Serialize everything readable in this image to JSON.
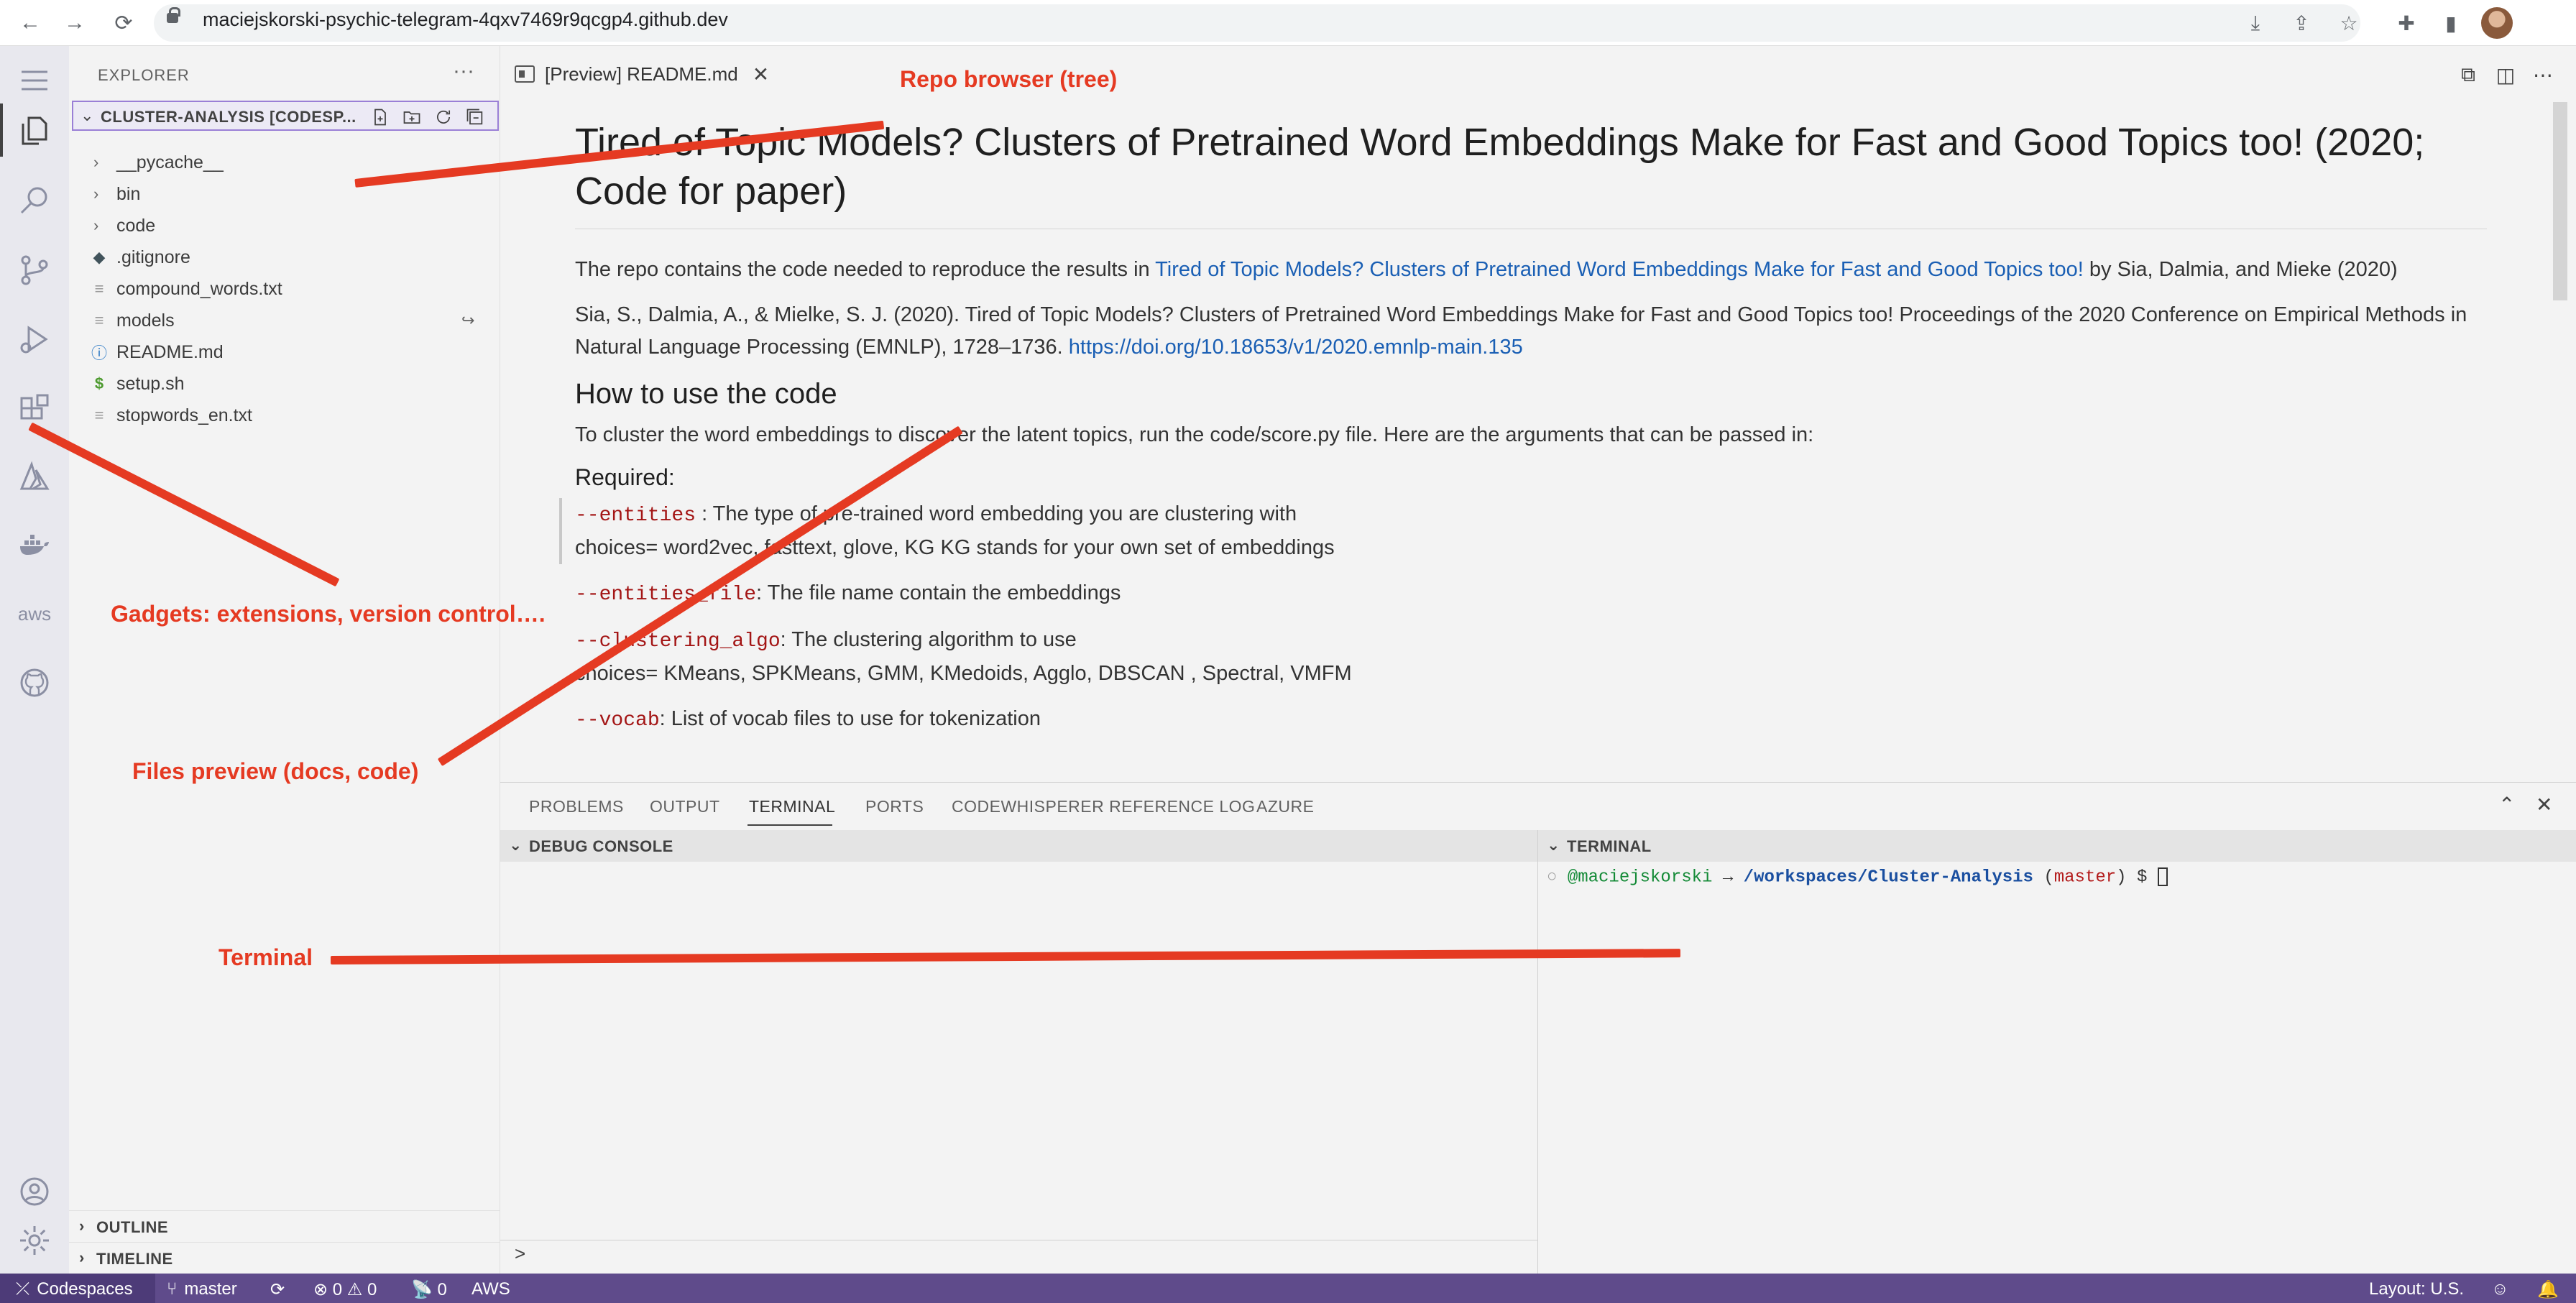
{
  "browser": {
    "url": "maciejskorski-psychic-telegram-4qxv7469r9qcgp4.github.dev"
  },
  "explorer": {
    "title": "EXPLORER",
    "more": "···",
    "repo_name": "CLUSTER-ANALYSIS [CODESP...",
    "files": [
      {
        "name": "__pycache__",
        "type": "folder"
      },
      {
        "name": "bin",
        "type": "folder"
      },
      {
        "name": "code",
        "type": "folder"
      },
      {
        "name": ".gitignore",
        "type": "git"
      },
      {
        "name": "compound_words.txt",
        "type": "text"
      },
      {
        "name": "models",
        "type": "text"
      },
      {
        "name": "README.md",
        "type": "info"
      },
      {
        "name": "setup.sh",
        "type": "shell"
      },
      {
        "name": "stopwords_en.txt",
        "type": "text"
      }
    ],
    "outline_label": "OUTLINE",
    "timeline_label": "TIMELINE"
  },
  "editor": {
    "tab_label": "[Preview] README.md",
    "h1": "Tired of Topic Models? Clusters of Pretrained Word Embeddings Make for Fast and Good Topics too! (2020; Code for paper)",
    "p1_before": "The repo contains the code needed to reproduce the results in ",
    "p1_link": "Tired of Topic Models? Clusters of Pretrained Word Embeddings Make for Fast and Good Topics too!",
    "p1_after": " by Sia, Dalmia, and Mieke (2020)",
    "p2_text": "Sia, S., Dalmia, A., & Mielke, S. J. (2020). Tired of Topic Models? Clusters of Pretrained Word Embeddings Make for Fast and Good Topics too! Proceedings of the 2020 Conference on Empirical Methods in Natural Language Processing (EMNLP), 1728–1736. ",
    "p2_link": "https://doi.org/10.18653/v1/2020.emnlp-main.135",
    "h2": "How to use the code",
    "p3": "To cluster the word embeddings to discover the latent topics, run the code/score.py file. Here are the arguments that can be passed in:",
    "h3": "Required:",
    "arg1_code": "--entities",
    "arg1_desc": " : The type of pre-trained word embedding you are clustering with",
    "arg1_choices": "choices= word2vec, fasttext, glove, KG KG stands for your own set of embeddings",
    "arg2_code": "--entities_file",
    "arg2_desc": ": The file name contain the embeddings",
    "arg3_code": "--clustering_algo",
    "arg3_desc": ": The clustering algorithm to use",
    "arg3_choices": "choices= KMeans, SPKMeans, GMM, KMedoids, Agglo, DBSCAN , Spectral, VMFM",
    "arg4_code": "--vocab",
    "arg4_desc": ": List of vocab files to use for tokenization"
  },
  "panel": {
    "tabs": [
      "PROBLEMS",
      "OUTPUT",
      "TERMINAL",
      "PORTS",
      "CODEWHISPERER REFERENCE LOG",
      "AZURE"
    ],
    "active_tab": "TERMINAL",
    "debug_console_label": "DEBUG CONSOLE",
    "debug_prompt": ">",
    "terminal_label": "TERMINAL",
    "terminal": {
      "dot": "○",
      "user": "@maciejskorski",
      "arrow": " → ",
      "path": "/workspaces/Cluster-Analysis",
      "branch": "master",
      "prompt": " $ "
    }
  },
  "status": {
    "remote": "Codespaces",
    "branch": "master",
    "sync": "⟳",
    "problems": "⊗ 0 ⚠ 0",
    "ports": "📡 0",
    "aws": "AWS",
    "layout": "Layout: U.S."
  },
  "annotations": {
    "repo_browser": "Repo browser (tree)",
    "gadgets": "Gadgets: extensions, version control….",
    "files_preview": "Files preview (docs, code)",
    "terminal": "Terminal"
  },
  "colors": {
    "annotation": "#e53a22",
    "status_bar": "#5f4b8b",
    "link": "#1a5fb4",
    "code": "#a31515"
  }
}
